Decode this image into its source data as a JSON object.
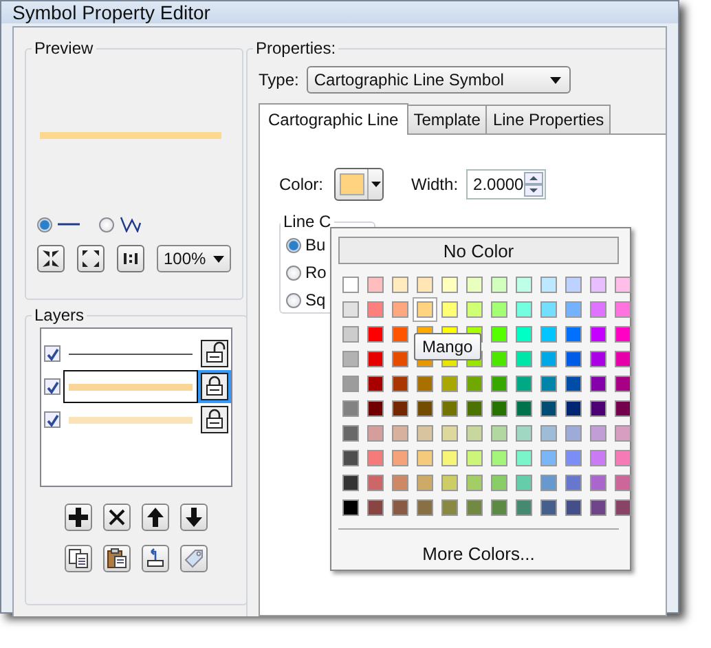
{
  "window": {
    "title": "Symbol Property Editor"
  },
  "preview": {
    "title": "Preview",
    "color": "#fcd98f",
    "modes": [
      {
        "kind": "line",
        "selected": true
      },
      {
        "kind": "zigzag",
        "selected": false
      }
    ],
    "zoom_buttons": [
      {
        "kind": "shrink"
      },
      {
        "kind": "expand"
      },
      {
        "kind": "actual"
      }
    ],
    "zoom": "100%"
  },
  "layers": {
    "title": "Layers",
    "items": [
      {
        "color": "#555555",
        "kind": "thin",
        "checked": true,
        "locked": false,
        "selected": false
      },
      {
        "color": "#f9d596",
        "kind": "thick",
        "checked": true,
        "locked": true,
        "selected": true
      },
      {
        "color": "#fbe3b8",
        "kind": "thick",
        "checked": true,
        "locked": true,
        "selected": false
      }
    ],
    "buttons": [
      {
        "kind": "add"
      },
      {
        "kind": "delete"
      },
      {
        "kind": "up"
      },
      {
        "kind": "down"
      },
      {
        "kind": "copy"
      },
      {
        "kind": "paste"
      },
      {
        "kind": "reset"
      },
      {
        "kind": "tag"
      }
    ]
  },
  "properties": {
    "title": "Properties:",
    "type_label": "Type:",
    "type_value": "Cartographic Line Symbol",
    "tabs": [
      {
        "label": "Cartographic Line",
        "selected": true
      },
      {
        "label": "Template",
        "selected": false
      },
      {
        "label": "Line Properties",
        "selected": false
      }
    ],
    "color_label": "Color:",
    "color": "#ffd37f",
    "width_label": "Width:",
    "width_value": "2.0000",
    "line_caps": {
      "title": "Line C",
      "options": [
        {
          "label": "Bu",
          "selected": true
        },
        {
          "label": "Ro",
          "selected": false
        },
        {
          "label": "Sq",
          "selected": false
        }
      ]
    }
  },
  "color_picker": {
    "no_color": "No Color",
    "tooltip": "Mango",
    "more": "More Colors...",
    "rows": [
      {
        "swatches": [
          {
            "color": "#ffffff",
            "selected": false
          },
          {
            "color": "#ffbebe",
            "selected": false
          },
          {
            "color": "#ffebbe",
            "selected": false
          },
          {
            "color": "#ffe6b4",
            "selected": false
          },
          {
            "color": "#ffffbe",
            "selected": false
          },
          {
            "color": "#e9ffbe",
            "selected": false
          },
          {
            "color": "#d3ffbe",
            "selected": false
          },
          {
            "color": "#beffe8",
            "selected": false
          },
          {
            "color": "#bee8ff",
            "selected": false
          },
          {
            "color": "#bed2ff",
            "selected": false
          },
          {
            "color": "#e8beff",
            "selected": false
          },
          {
            "color": "#ffbee8",
            "selected": false
          }
        ]
      },
      {
        "swatches": [
          {
            "color": "#e1e1e1",
            "selected": false
          },
          {
            "color": "#ff7f7f",
            "selected": false
          },
          {
            "color": "#ffa77f",
            "selected": false
          },
          {
            "color": "#ffd37f",
            "selected": true
          },
          {
            "color": "#ffff73",
            "selected": false
          },
          {
            "color": "#d1ff73",
            "selected": false
          },
          {
            "color": "#a3ff73",
            "selected": false
          },
          {
            "color": "#73ffdf",
            "selected": false
          },
          {
            "color": "#73dfff",
            "selected": false
          },
          {
            "color": "#73b2ff",
            "selected": false
          },
          {
            "color": "#df73ff",
            "selected": false
          },
          {
            "color": "#ff73df",
            "selected": false
          }
        ]
      },
      {
        "swatches": [
          {
            "color": "#cccccc",
            "selected": false
          },
          {
            "color": "#ff0000",
            "selected": false
          },
          {
            "color": "#ff5500",
            "selected": false
          },
          {
            "color": "#ffaa00",
            "selected": false
          },
          {
            "color": "#ffff00",
            "selected": false
          },
          {
            "color": "#aaff00",
            "selected": false
          },
          {
            "color": "#55ff00",
            "selected": false
          },
          {
            "color": "#00ffc5",
            "selected": false
          },
          {
            "color": "#00c5ff",
            "selected": false
          },
          {
            "color": "#0070ff",
            "selected": false
          },
          {
            "color": "#c500ff",
            "selected": false
          },
          {
            "color": "#ff00c5",
            "selected": false
          }
        ]
      },
      {
        "swatches": [
          {
            "color": "#b2b2b2",
            "selected": false
          },
          {
            "color": "#e60000",
            "selected": false
          },
          {
            "color": "#e64c00",
            "selected": false
          },
          {
            "color": "#e69800",
            "selected": false
          },
          {
            "color": "#e6e600",
            "selected": false
          },
          {
            "color": "#98e600",
            "selected": false
          },
          {
            "color": "#4ce600",
            "selected": false
          },
          {
            "color": "#00e6a9",
            "selected": false
          },
          {
            "color": "#00a9e6",
            "selected": false
          },
          {
            "color": "#005ce6",
            "selected": false
          },
          {
            "color": "#a900e6",
            "selected": false
          },
          {
            "color": "#e600a9",
            "selected": false
          }
        ]
      },
      {
        "swatches": [
          {
            "color": "#9c9c9c",
            "selected": false
          },
          {
            "color": "#a80000",
            "selected": false
          },
          {
            "color": "#a83800",
            "selected": false
          },
          {
            "color": "#a87000",
            "selected": false
          },
          {
            "color": "#a8a800",
            "selected": false
          },
          {
            "color": "#70a800",
            "selected": false
          },
          {
            "color": "#38a800",
            "selected": false
          },
          {
            "color": "#00a884",
            "selected": false
          },
          {
            "color": "#0084a8",
            "selected": false
          },
          {
            "color": "#004da8",
            "selected": false
          },
          {
            "color": "#8400a8",
            "selected": false
          },
          {
            "color": "#a80084",
            "selected": false
          }
        ]
      },
      {
        "swatches": [
          {
            "color": "#828282",
            "selected": false
          },
          {
            "color": "#730000",
            "selected": false
          },
          {
            "color": "#732600",
            "selected": false
          },
          {
            "color": "#734c00",
            "selected": false
          },
          {
            "color": "#737300",
            "selected": false
          },
          {
            "color": "#4c7300",
            "selected": false
          },
          {
            "color": "#267300",
            "selected": false
          },
          {
            "color": "#00734c",
            "selected": false
          },
          {
            "color": "#004c73",
            "selected": false
          },
          {
            "color": "#002673",
            "selected": false
          },
          {
            "color": "#4c0073",
            "selected": false
          },
          {
            "color": "#73004c",
            "selected": false
          }
        ]
      },
      {
        "swatches": [
          {
            "color": "#686868",
            "selected": false
          },
          {
            "color": "#d69d9d",
            "selected": false
          },
          {
            "color": "#d7b19e",
            "selected": false
          },
          {
            "color": "#d8c49e",
            "selected": false
          },
          {
            "color": "#dcd89e",
            "selected": false
          },
          {
            "color": "#c7d79e",
            "selected": false
          },
          {
            "color": "#b2d7a0",
            "selected": false
          },
          {
            "color": "#9fd7c3",
            "selected": false
          },
          {
            "color": "#9ebcd7",
            "selected": false
          },
          {
            "color": "#9eaad7",
            "selected": false
          },
          {
            "color": "#c29ed7",
            "selected": false
          },
          {
            "color": "#d79ec2",
            "selected": false
          }
        ]
      },
      {
        "swatches": [
          {
            "color": "#4e4e4e",
            "selected": false
          },
          {
            "color": "#f57a7a",
            "selected": false
          },
          {
            "color": "#f5a27a",
            "selected": false
          },
          {
            "color": "#f5ca7a",
            "selected": false
          },
          {
            "color": "#f5f57a",
            "selected": false
          },
          {
            "color": "#cdf57a",
            "selected": false
          },
          {
            "color": "#a5f57a",
            "selected": false
          },
          {
            "color": "#7af5ca",
            "selected": false
          },
          {
            "color": "#7ab6f5",
            "selected": false
          },
          {
            "color": "#7a8ef5",
            "selected": false
          },
          {
            "color": "#ca7af5",
            "selected": false
          },
          {
            "color": "#f57ab6",
            "selected": false
          }
        ]
      },
      {
        "swatches": [
          {
            "color": "#343434",
            "selected": false
          },
          {
            "color": "#cd6666",
            "selected": false
          },
          {
            "color": "#cd8966",
            "selected": false
          },
          {
            "color": "#cdaa66",
            "selected": false
          },
          {
            "color": "#cdcd66",
            "selected": false
          },
          {
            "color": "#a5cd66",
            "selected": false
          },
          {
            "color": "#89cd66",
            "selected": false
          },
          {
            "color": "#66cdab",
            "selected": false
          },
          {
            "color": "#6699cd",
            "selected": false
          },
          {
            "color": "#6677cd",
            "selected": false
          },
          {
            "color": "#ab66cd",
            "selected": false
          },
          {
            "color": "#cd6699",
            "selected": false
          }
        ]
      },
      {
        "swatches": [
          {
            "color": "#000000",
            "selected": false
          },
          {
            "color": "#894444",
            "selected": false
          },
          {
            "color": "#895a44",
            "selected": false
          },
          {
            "color": "#897044",
            "selected": false
          },
          {
            "color": "#898944",
            "selected": false
          },
          {
            "color": "#728944",
            "selected": false
          },
          {
            "color": "#5c8944",
            "selected": false
          },
          {
            "color": "#448970",
            "selected": false
          },
          {
            "color": "#445f89",
            "selected": false
          },
          {
            "color": "#444f89",
            "selected": false
          },
          {
            "color": "#704489",
            "selected": false
          },
          {
            "color": "#894465",
            "selected": false
          }
        ]
      }
    ]
  }
}
